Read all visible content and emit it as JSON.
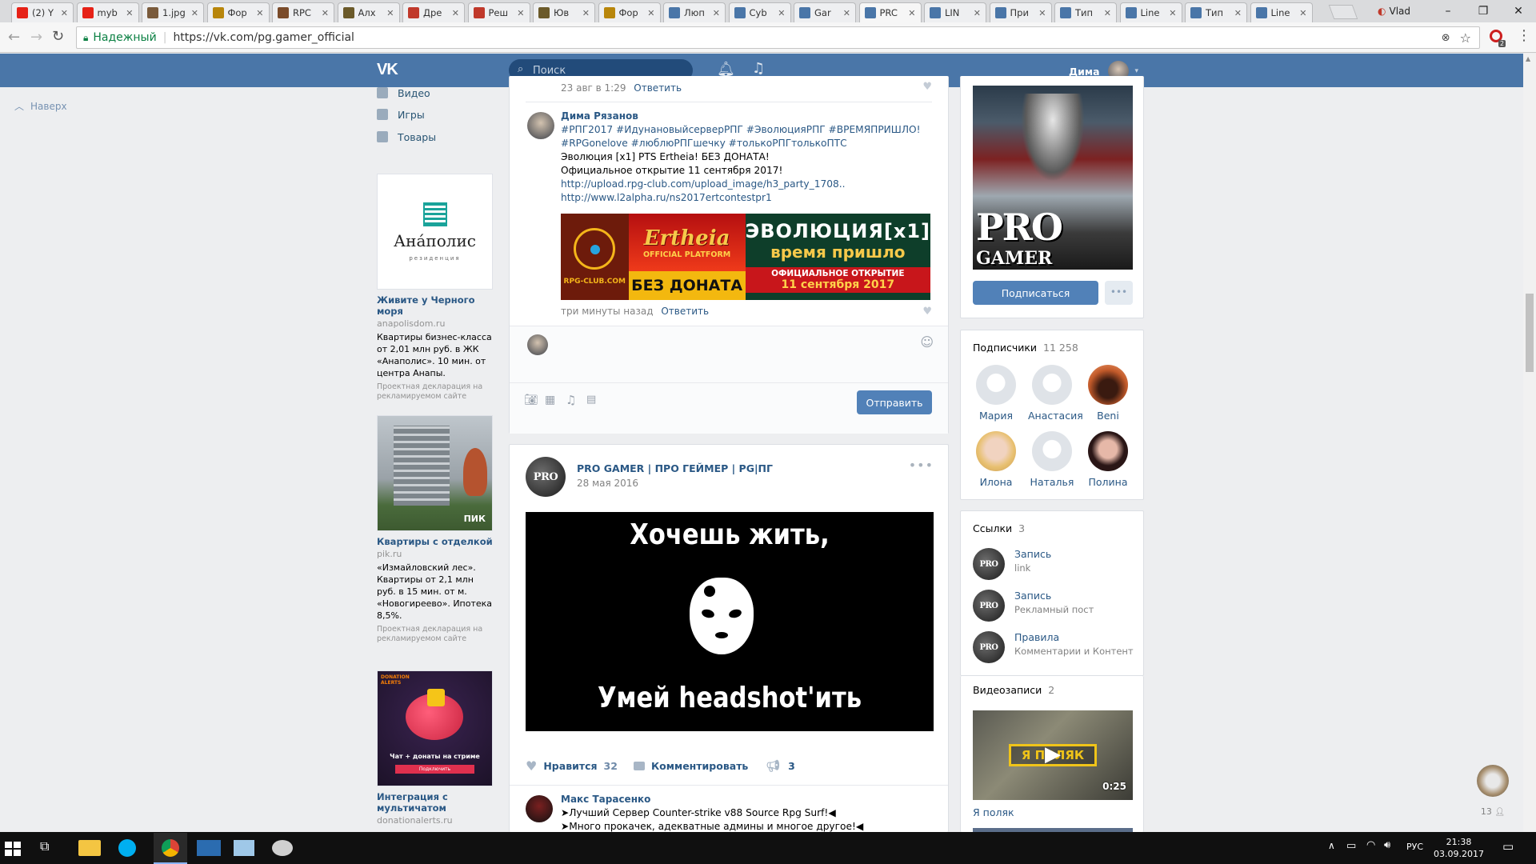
{
  "browser": {
    "tabs": [
      {
        "title": "(2) Y",
        "color": "#e62117"
      },
      {
        "title": "myb",
        "color": "#e62117"
      },
      {
        "title": "1.jpg",
        "color": "#7a5b3c"
      },
      {
        "title": "Фор",
        "color": "#b8860b"
      },
      {
        "title": "RPC",
        "color": "#7a4b2a"
      },
      {
        "title": "Алх",
        "color": "#6b5a2a"
      },
      {
        "title": "Дре",
        "color": "#c0392b"
      },
      {
        "title": "Реш",
        "color": "#c0392b"
      },
      {
        "title": "Юв",
        "color": "#6b5a2a"
      },
      {
        "title": "Фор",
        "color": "#b8860b"
      },
      {
        "title": "Люп",
        "color": "#4a76a8"
      },
      {
        "title": "Cyb",
        "color": "#4a76a8"
      },
      {
        "title": "Gar",
        "color": "#4a76a8"
      },
      {
        "title": "PRC",
        "color": "#4a76a8"
      },
      {
        "title": "LIN",
        "color": "#4a76a8"
      },
      {
        "title": "При",
        "color": "#4a76a8"
      },
      {
        "title": "Тип",
        "color": "#4a76a8"
      },
      {
        "title": "Line",
        "color": "#4a76a8"
      },
      {
        "title": "Тип",
        "color": "#4a76a8"
      },
      {
        "title": "Line",
        "color": "#4a76a8"
      }
    ],
    "active_tab": 13,
    "user_badge": "Vlad",
    "secure_label": "Надежный",
    "url": "https://vk.com/pg.gamer_official",
    "ext_badge": "2"
  },
  "vk": {
    "logo": "VK",
    "search_placeholder": "Поиск",
    "user_name": "Дима",
    "back_top": "Наверх"
  },
  "left_menu": [
    {
      "label": "Видео"
    },
    {
      "label": "Игры"
    },
    {
      "label": "Товары"
    }
  ],
  "ads": [
    {
      "title": "Живите у Черного моря",
      "domain": "anapolisdom.ru",
      "text": "Квартиры бизнес-класса от 2,01 млн руб. в ЖК «Анаполис». 10 мин. от центра Анапы.",
      "note": "Проектная декларация на рекламируемом сайте",
      "logo_text": "Ана́полис",
      "logo_sub": "резиденция"
    },
    {
      "title": "Квартиры с отделкой",
      "domain": "pik.ru",
      "text": "«Измайловский лес». Квартиры от 2,1 млн руб. в 15 мин. от м. «Новогиреево». Ипотека 8,5%.",
      "note": "Проектная декларация на рекламируемом сайте",
      "badge": "ПИК"
    },
    {
      "title": "Интеграция с мультичатом",
      "domain": "donationalerts.ru",
      "banner": "Чат + донаты на стриме",
      "cta": "Подключить",
      "logo": "DONATION ALERTS"
    }
  ],
  "feed": {
    "prev_comment": {
      "time": "23 авг в 1:29",
      "reply": "Ответить"
    },
    "comment": {
      "author": "Дима Рязанов",
      "hashtags1": "#РПГ2017 #ИдунановыйсерверРПГ #ЭволюцияРПГ #ВРЕМЯПРИШЛО!",
      "hashtags2": "#RPGonelove #люблюРПГшечку #толькоРПГтолькоПТС",
      "line1": "Эволюция [x1] PTS Ertheia! БЕЗ ДОНАТА!",
      "line2": "Официальное открытие 11 сентября 2017!",
      "link1": "http://upload.rpg-club.com/upload_image/h3_party_1708..",
      "link2": "http://www.l2alpha.ru/ns2017ertcontestpr1",
      "time": "три минуты назад",
      "reply": "Ответить",
      "banner": {
        "rpg": "RPG-CLUB.COM",
        "ertheia": "Ertheia",
        "official": "OFFICIAL PLATFORM",
        "nodonate": "БЕЗ ДОНАТА",
        "evo": "ЭВОЛЮЦИЯ[x1]",
        "time": "время пришло",
        "open1": "ОФИЦИАЛЬНОЕ ОТКРЫТИЕ",
        "open2": "11 сентября 2017"
      }
    },
    "send_label": "Отправить",
    "post": {
      "author": "PRO GAMER | ПРО ГЕЙМЕР | PG|ПГ",
      "date": "28 мая 2016",
      "img_top": "Хочешь жить,",
      "img_bottom": "Умей headshot'ить",
      "like_label": "Нравится",
      "like_count": "32",
      "comment_label": "Комментировать",
      "share_count": "3"
    },
    "next_comment": {
      "author": "Макс Тарасенко",
      "line1": "➤Лучший Сервер Counter-strike v88 Source Rpg Surf!◀",
      "line2": "➤Много прокачек, адекватные админы и многое другое!◀"
    }
  },
  "group": {
    "cover_pro": "PRO",
    "cover_gamer": "GAMER",
    "subscribe": "Подписаться",
    "subscribers_label": "Подписчики",
    "subscribers_count": "11 258",
    "subscribers": [
      {
        "name": "Мария"
      },
      {
        "name": "Анастасия"
      },
      {
        "name": "Beni"
      },
      {
        "name": "Илона"
      },
      {
        "name": "Наталья"
      },
      {
        "name": "Полина"
      }
    ],
    "links_label": "Ссылки",
    "links_count": "3",
    "links": [
      {
        "title": "Запись",
        "desc": "link"
      },
      {
        "title": "Запись",
        "desc": "Рекламный пост"
      },
      {
        "title": "Правила",
        "desc": "Комментарии и Контент"
      }
    ],
    "videos_label": "Видеозаписи",
    "videos_count": "2",
    "video": {
      "title": "Я поляк",
      "duration": "0:25",
      "overlay": "Я ПОЛЯК"
    }
  },
  "chat": {
    "count": "13"
  },
  "taskbar": {
    "time": "21:38",
    "date": "03.09.2017",
    "lang": "РУС"
  }
}
